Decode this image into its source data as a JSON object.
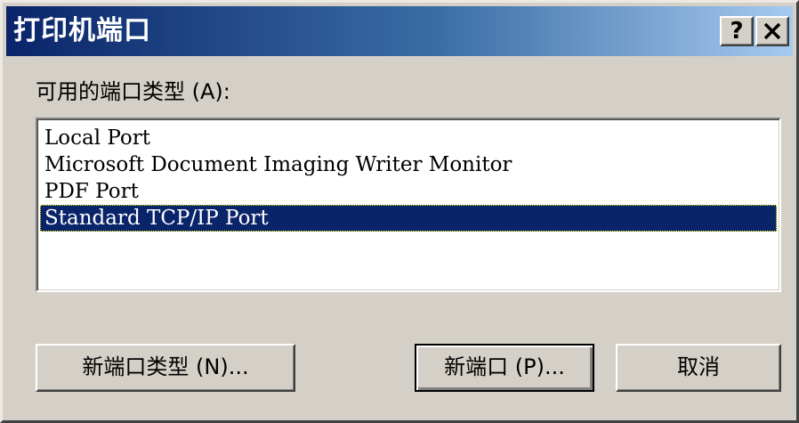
{
  "window": {
    "title": "打印机端口",
    "help_label": "?",
    "close_label": "✕"
  },
  "port_types": {
    "label": "可用的端口类型 (A):",
    "items": [
      {
        "label": "Local Port",
        "selected": false
      },
      {
        "label": "Microsoft Document Imaging Writer Monitor",
        "selected": false
      },
      {
        "label": "PDF Port",
        "selected": false
      },
      {
        "label": "Standard TCP/IP Port",
        "selected": true
      }
    ]
  },
  "buttons": {
    "new_port_type": "新端口类型 (N)...",
    "new_port": "新端口 (P)...",
    "cancel": "取消"
  },
  "colors": {
    "title_gradient_start": "#0a246a",
    "title_gradient_end": "#a6caf0",
    "selection": "#0a246a",
    "dialog_face": "#d4d0c8"
  }
}
